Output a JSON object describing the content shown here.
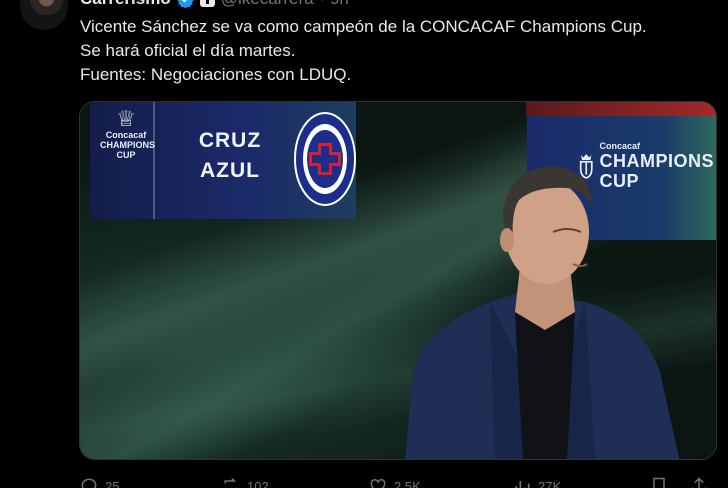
{
  "tweet": {
    "display_name": "Carrerismo",
    "handle": "@ikecarrera",
    "time": "· 9h",
    "lines": [
      "Vicente Sánchez se va como campeón de la CONCACAF Champions Cup.",
      "Se hará oficial el día martes.",
      "Fuentes: Negociaciones con LDUQ."
    ]
  },
  "media": {
    "board_left": {
      "small_text": "Concacaf",
      "champions": "CHAMPIONS",
      "cup": "CUP",
      "team_line1": "CRUZ",
      "team_line2": "AZUL"
    },
    "board_right": {
      "small_text": "Concacaf",
      "champions": "CHAMPIONS",
      "cup": "CUP"
    }
  },
  "actions": {
    "replies": "25",
    "reposts": "102",
    "likes": "2.5K",
    "views": "27K"
  },
  "colors": {
    "background": "#000000",
    "text": "#e7e9ea",
    "muted": "#71767b",
    "verified": "#1d9bf0"
  }
}
